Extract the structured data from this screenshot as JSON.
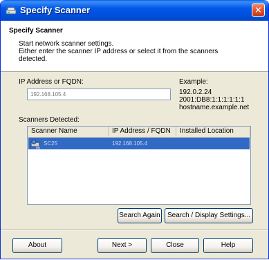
{
  "window": {
    "title": "Specify Scanner",
    "close_glyph": "✕"
  },
  "header": {
    "title": "Specify Scanner",
    "desc_line1": "Start network scanner settings.",
    "desc_line2": "Either enter the scanner IP address or select it from the scanners",
    "desc_line3": "detected."
  },
  "ip": {
    "label": "IP Address or FQDN:",
    "value": "192.168.105.4"
  },
  "example": {
    "label": "Example:",
    "line1": "192.0.2.24",
    "line2": "2001:DB8:1:1:1:1:1:1",
    "line3": "hostname.example.net"
  },
  "scanners": {
    "label": "Scanners Detected:",
    "columns": [
      "Scanner Name",
      "IP Address / FQDN",
      "Installed Location"
    ],
    "rows": [
      {
        "name": "SC25",
        "ip": "192.168.105.4",
        "location": ""
      }
    ]
  },
  "buttons": {
    "search_again": "Search Again",
    "search_display_settings": "Search / Display Settings...",
    "about": "About",
    "next": "Next >",
    "close": "Close",
    "help": "Help"
  },
  "colors": {
    "titlebar": "#0058e8",
    "selection": "#316ac5",
    "dialog_bg": "#ece9d8"
  },
  "icons": {
    "title": "scanner-icon",
    "row": "scanner-network-icon",
    "close": "close-icon"
  }
}
